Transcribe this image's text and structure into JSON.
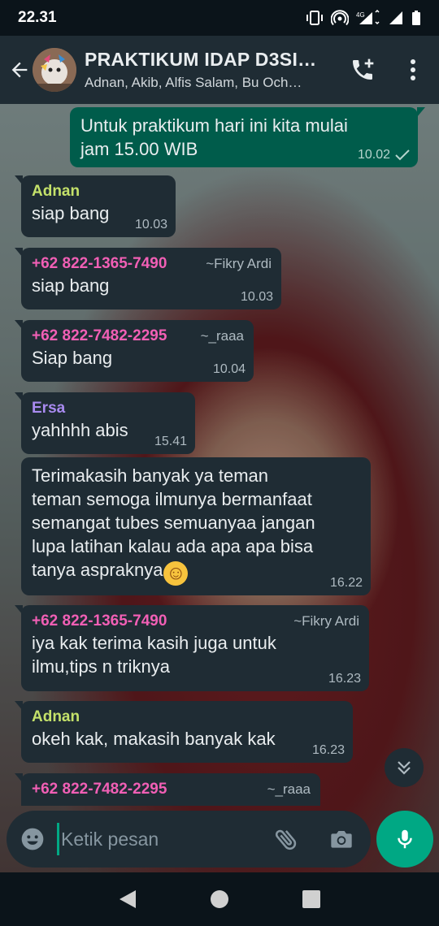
{
  "status_bar": {
    "time": "22.31",
    "network": "4G"
  },
  "header": {
    "title": "PRAKTIKUM IDAP D3SI…",
    "subtitle": "Adnan, Akib, Alfis Salam, Bu Och…",
    "icons": [
      "back-arrow-icon",
      "group-avatar",
      "add-call-icon",
      "more-vert-icon"
    ]
  },
  "messages": [
    {
      "direction": "out",
      "text": "Untuk praktikum hari ini kita mulai\njam 15.00 WIB",
      "time": "10.02",
      "status": "sent-check"
    },
    {
      "direction": "in",
      "sender": "Adnan",
      "sender_color": "#c4e16a",
      "text": "siap bang",
      "time": "10.03"
    },
    {
      "direction": "in",
      "sender": "+62 822-1365-7490",
      "alias": "~Fikry Ardi",
      "sender_color": "#f15fb5",
      "text": "siap bang",
      "time": "10.03"
    },
    {
      "direction": "in",
      "sender": "+62 822-7482-2295",
      "alias": "~_raaa",
      "sender_color": "#f15fb5",
      "text": "Siap bang",
      "time": "10.04"
    },
    {
      "direction": "in",
      "sender": "Ersa",
      "sender_color": "#a98bf0",
      "text": "yahhhh abis",
      "time": "15.41"
    },
    {
      "direction": "in",
      "text": "Terimakasih banyak ya teman\nteman semoga ilmunya bermanfaat\nsemangat tubes semuanyaa jangan\nlupa latihan kalau ada apa apa bisa\ntanya aspraknya",
      "emoji": "☺",
      "time": "16.22"
    },
    {
      "direction": "in",
      "sender": "+62 822-1365-7490",
      "alias": "~Fikry Ardi",
      "sender_color": "#f15fb5",
      "text": "iya kak terima kasih juga untuk\nilmu,tips n triknya",
      "time": "16.23"
    },
    {
      "direction": "in",
      "sender": "Adnan",
      "sender_color": "#c4e16a",
      "text": "okeh kak, makasih banyak kak",
      "time": "16.23"
    },
    {
      "direction": "in",
      "sender": "+62 822-7482-2295",
      "alias": "~_raaa",
      "sender_color": "#f15fb5",
      "text": ""
    }
  ],
  "composer": {
    "placeholder": "Ketik pesan",
    "icons": [
      "emoji-icon",
      "attach-icon",
      "camera-icon",
      "mic-icon"
    ]
  },
  "colors": {
    "header_bg": "#1f2c34",
    "incoming_bubble": "#1f2c34",
    "outgoing_bubble": "#005c4b",
    "accent": "#00a884"
  }
}
